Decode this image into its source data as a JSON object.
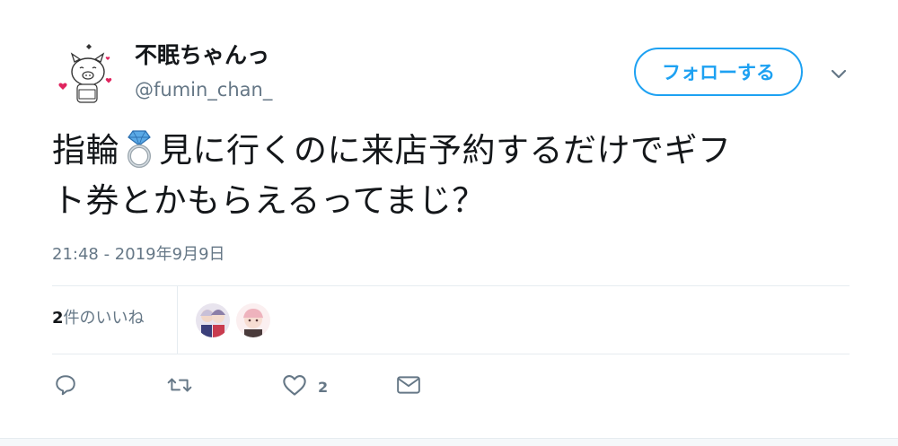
{
  "user": {
    "display_name": "不眠ちゃんっ",
    "handle": "@fumin_chan_"
  },
  "header": {
    "follow_label": "フォローする",
    "menu_icon": "chevron-down-icon"
  },
  "tweet": {
    "text_line1_before": "指輪",
    "emoji": "ring-emoji",
    "text_line1_after": "見に行くのに来店予約するだけでギフ",
    "text_line2": "ト券とかもらえるってまじ？",
    "timestamp": "21:48 - 2019年9月9日"
  },
  "likes": {
    "count": "2",
    "label": "件のいいね"
  },
  "actions": {
    "reply_icon": "reply-icon",
    "retweet_icon": "retweet-icon",
    "like_icon": "heart-icon",
    "like_count": "2",
    "dm_icon": "envelope-icon"
  },
  "colors": {
    "accent": "#1da1f2",
    "secondary_text": "#657786",
    "primary_text": "#14171a",
    "divider": "#e6ecf0"
  }
}
